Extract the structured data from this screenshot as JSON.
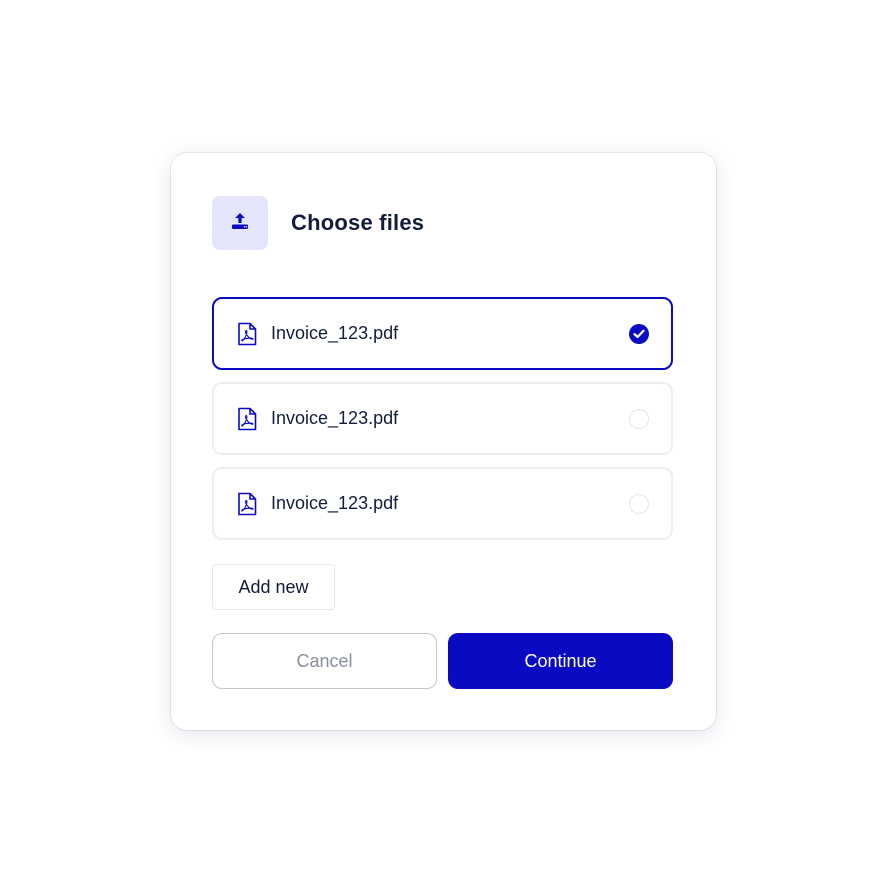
{
  "dialog": {
    "title": "Choose files",
    "header_icon": "upload-icon"
  },
  "files": [
    {
      "name": "Invoice_123.pdf",
      "icon": "pdf-file-icon",
      "selected": true
    },
    {
      "name": "Invoice_123.pdf",
      "icon": "pdf-file-icon",
      "selected": false
    },
    {
      "name": "Invoice_123.pdf",
      "icon": "pdf-file-icon",
      "selected": false
    }
  ],
  "actions": {
    "add_new_label": "Add new",
    "cancel_label": "Cancel",
    "continue_label": "Continue"
  },
  "colors": {
    "accent": "#0a0ac2",
    "icon_bg": "#e4e4fb",
    "text": "#131c3d",
    "muted": "#8a8f9c"
  }
}
